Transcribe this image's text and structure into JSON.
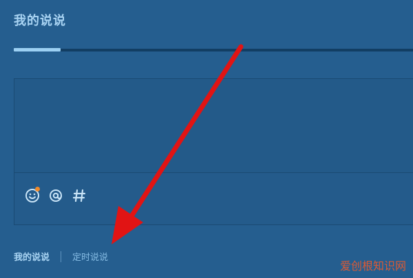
{
  "header": {
    "title": "我的说说"
  },
  "composer": {
    "emoji_icon": "emoji-icon",
    "mention_icon": "at-icon",
    "topic_icon": "hash-icon"
  },
  "bottom_nav": {
    "my_posts": "我的说说",
    "scheduled_posts": "定时说说"
  },
  "annotation": {
    "arrow_color": "#e11414"
  },
  "watermark": {
    "text": "爱创根知识网"
  }
}
